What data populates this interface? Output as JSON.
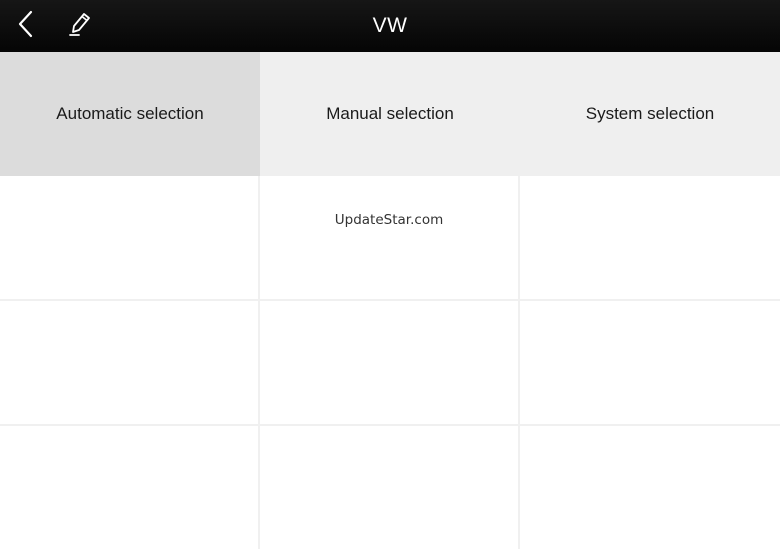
{
  "header": {
    "title": "VW",
    "back_icon": "chevron-left-icon",
    "edit_icon": "pencil-icon"
  },
  "tabs": [
    {
      "label": "Automatic selection",
      "active": true
    },
    {
      "label": "Manual selection",
      "active": false
    },
    {
      "label": "System selection",
      "active": false
    }
  ],
  "grid": {
    "rows": 3,
    "columns": 3,
    "watermark": "UpdateStar.com"
  },
  "colors": {
    "topbar": "#0a0a0a",
    "tab_background": "#efefef",
    "tab_active_background": "#dcdcdc",
    "grid_line": "#f0f0f0"
  }
}
